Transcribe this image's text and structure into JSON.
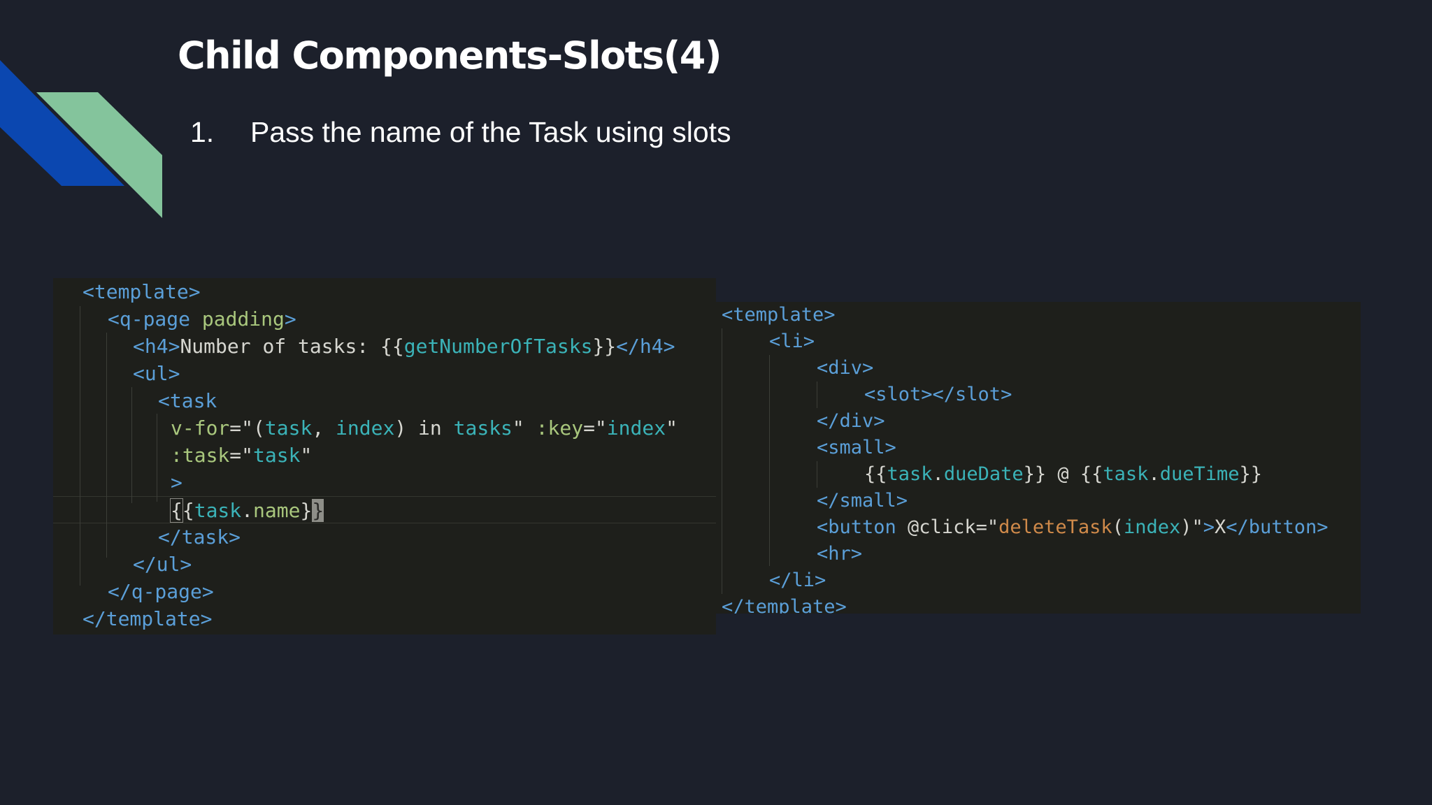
{
  "slide": {
    "title": "Child Components-Slots(4)",
    "bullets": [
      {
        "number": "1.",
        "text": "Pass the name of the Task using slots"
      }
    ]
  },
  "colors": {
    "background": "#1c202b",
    "decor_blue": "#0b47b0",
    "decor_green": "#84c49c",
    "code_background": "#1e1f1b",
    "tag": "#5b9fd8",
    "attribute": "#a9c77d",
    "expression": "#3bb3b8",
    "function": "#d08a4a",
    "plain": "#d6d6d0"
  },
  "code_left": {
    "lines": [
      {
        "tokens": [
          {
            "t": "<template>",
            "c": "tg"
          }
        ]
      },
      {
        "tokens": [
          {
            "t": "<q-page",
            "c": "tg"
          },
          {
            "t": " padding",
            "c": "at"
          },
          {
            "t": ">",
            "c": "tg"
          }
        ]
      },
      {
        "tokens": [
          {
            "t": "<h4>",
            "c": "tg"
          },
          {
            "t": "Number of tasks: {{",
            "c": "pl"
          },
          {
            "t": "getNumberOfTasks",
            "c": "ex"
          },
          {
            "t": "}}",
            "c": "pl"
          },
          {
            "t": "</h4>",
            "c": "tg"
          }
        ]
      },
      {
        "tokens": [
          {
            "t": "<ul>",
            "c": "tg"
          }
        ]
      },
      {
        "tokens": [
          {
            "t": "<task",
            "c": "tg"
          }
        ]
      },
      {
        "tokens": [
          {
            "t": "v-for",
            "c": "at"
          },
          {
            "t": "=\"(",
            "c": "pl"
          },
          {
            "t": "task",
            "c": "ex"
          },
          {
            "t": ", ",
            "c": "pl"
          },
          {
            "t": "index",
            "c": "ex"
          },
          {
            "t": ") in ",
            "c": "pl"
          },
          {
            "t": "tasks",
            "c": "ex"
          },
          {
            "t": "\" ",
            "c": "pl"
          },
          {
            "t": ":key",
            "c": "at"
          },
          {
            "t": "=\"",
            "c": "pl"
          },
          {
            "t": "index",
            "c": "ex"
          },
          {
            "t": "\"",
            "c": "pl"
          }
        ]
      },
      {
        "tokens": [
          {
            "t": ":task",
            "c": "at"
          },
          {
            "t": "=\"",
            "c": "pl"
          },
          {
            "t": "task",
            "c": "ex"
          },
          {
            "t": "\"",
            "c": "pl"
          }
        ]
      },
      {
        "tokens": [
          {
            "t": ">",
            "c": "tg"
          }
        ]
      },
      {
        "tokens": [
          {
            "t": "{",
            "c": "br brm"
          },
          {
            "t": "{",
            "c": "br"
          },
          {
            "t": "task",
            "c": "ex"
          },
          {
            "t": ".",
            "c": "pl"
          },
          {
            "t": "name",
            "c": "pr"
          },
          {
            "t": "}",
            "c": "br"
          },
          {
            "t": "}",
            "c": "cur"
          }
        ]
      },
      {
        "tokens": [
          {
            "t": "</task>",
            "c": "tg"
          }
        ]
      },
      {
        "tokens": [
          {
            "t": "</ul>",
            "c": "tg"
          }
        ]
      },
      {
        "tokens": [
          {
            "t": "</q-page>",
            "c": "tg"
          }
        ]
      },
      {
        "tokens": [
          {
            "t": "</template>",
            "c": "tg"
          }
        ]
      }
    ]
  },
  "code_right": {
    "lines": [
      {
        "tokens": [
          {
            "t": "<template>",
            "c": "tg"
          }
        ]
      },
      {
        "tokens": [
          {
            "t": "<li>",
            "c": "tg"
          }
        ]
      },
      {
        "tokens": [
          {
            "t": "<div>",
            "c": "tg"
          }
        ]
      },
      {
        "tokens": [
          {
            "t": "<slot></slot>",
            "c": "tg"
          }
        ]
      },
      {
        "tokens": [
          {
            "t": "</div>",
            "c": "tg"
          }
        ]
      },
      {
        "tokens": [
          {
            "t": "<small>",
            "c": "tg"
          }
        ]
      },
      {
        "tokens": [
          {
            "t": "{{",
            "c": "pl"
          },
          {
            "t": "task",
            "c": "ex"
          },
          {
            "t": ".",
            "c": "pl"
          },
          {
            "t": "dueDate",
            "c": "ex"
          },
          {
            "t": "}} @ {{",
            "c": "pl"
          },
          {
            "t": "task",
            "c": "ex"
          },
          {
            "t": ".",
            "c": "pl"
          },
          {
            "t": "dueTime",
            "c": "ex"
          },
          {
            "t": "}}",
            "c": "pl"
          }
        ]
      },
      {
        "tokens": [
          {
            "t": "</small>",
            "c": "tg"
          }
        ]
      },
      {
        "tokens": [
          {
            "t": "<button ",
            "c": "tg"
          },
          {
            "t": "@click",
            "c": "pl"
          },
          {
            "t": "=\"",
            "c": "pl"
          },
          {
            "t": "deleteTask",
            "c": "fn"
          },
          {
            "t": "(",
            "c": "pl"
          },
          {
            "t": "index",
            "c": "ex"
          },
          {
            "t": ")\"",
            "c": "pl"
          },
          {
            "t": ">",
            "c": "tg"
          },
          {
            "t": "X",
            "c": "pl"
          },
          {
            "t": "</button>",
            "c": "tg"
          }
        ]
      },
      {
        "tokens": [
          {
            "t": "<hr>",
            "c": "tg"
          }
        ]
      },
      {
        "tokens": [
          {
            "t": "</li>",
            "c": "tg"
          }
        ]
      },
      {
        "tokens": [
          {
            "t": "</template>",
            "c": "tg"
          }
        ]
      }
    ]
  }
}
